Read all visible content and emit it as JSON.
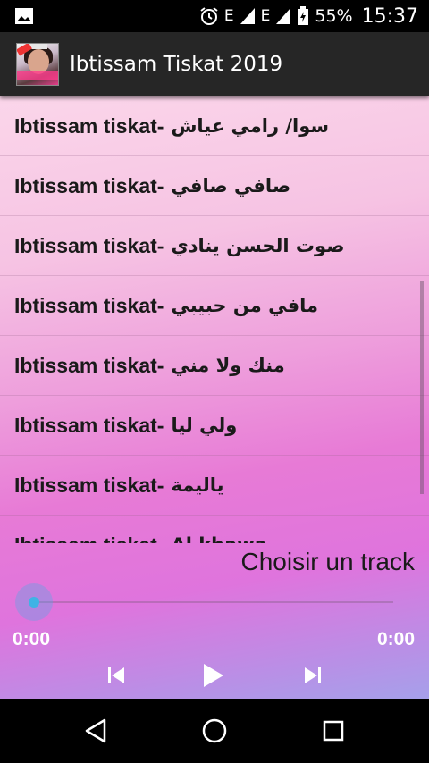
{
  "status_bar": {
    "network_1": "E",
    "network_2": "E",
    "battery": "55%",
    "time": "15:37",
    "icons": [
      "image-notification-icon",
      "alarm-icon",
      "signal-icon",
      "battery-icon"
    ]
  },
  "app_bar": {
    "title": "Ibtissam Tiskat 2019"
  },
  "tracks": [
    {
      "artist": "Ibtissam tiskat-",
      "name": "سوا/ رامي عياش"
    },
    {
      "artist": "Ibtissam tiskat-",
      "name": "صافي صافي"
    },
    {
      "artist": "Ibtissam tiskat-",
      "name": "صوت الحسن ينادي"
    },
    {
      "artist": "Ibtissam tiskat-",
      "name": "مافي من حبيبي"
    },
    {
      "artist": "Ibtissam tiskat-",
      "name": "منك ولا مني"
    },
    {
      "artist": "Ibtissam tiskat-",
      "name": "ولي ليا"
    },
    {
      "artist": "Ibtissam tiskat-",
      "name": "ياليمة"
    },
    {
      "artist": "Ibtissam tiskat-",
      "name": "Al khawa"
    }
  ],
  "player": {
    "choose_label": "Choisir un track",
    "time_start": "0:00",
    "time_end": "0:00",
    "progress": 0
  },
  "colors": {
    "accent": "#3fb3e5",
    "app_bar": "#262626"
  }
}
